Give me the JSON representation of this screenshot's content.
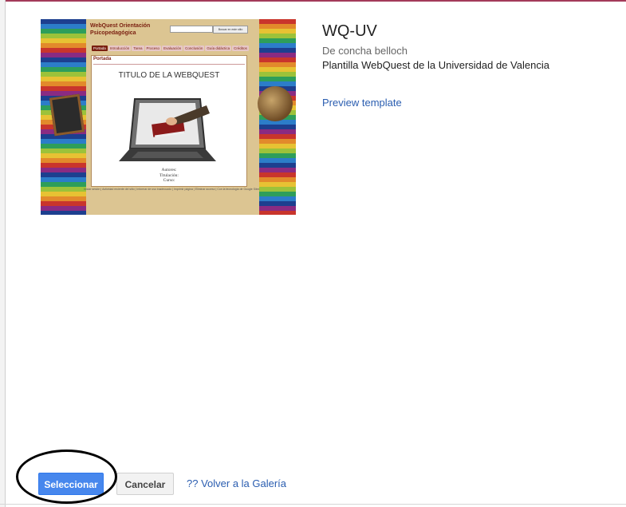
{
  "template": {
    "title": "WQ-UV",
    "author": "De concha belloch",
    "description": "Plantilla WebQuest de la Universidad de Valencia",
    "preview_link": "Preview template"
  },
  "thumbnail": {
    "site_title": "WebQuest Orientación Psicopedagógica",
    "search_button": "Buscar en este sitio",
    "nav": [
      "Portada",
      "Introducción",
      "Tarea",
      "Proceso",
      "Evaluación",
      "Conclusión",
      "Guía didáctica",
      "Créditos"
    ],
    "active_nav": "Portada",
    "page_label": "Portada",
    "heading": "TITULO DE LA WEBQUEST",
    "credits": [
      "Autores:",
      "Titulación:",
      "Curso:"
    ],
    "footer": "Iniciar sesión | Actividad reciente del sitio | Informar de uso inadecuado | Imprimir página | Eliminar acceso | Con la tecnología de Google Sites"
  },
  "actions": {
    "select_label": "Seleccionar",
    "cancel_label": "Cancelar",
    "back_label": "?? Volver a la Galería"
  },
  "colors": {
    "primary_button": "#4787ed",
    "link": "#2a5db0",
    "top_border": "#a33a5a"
  }
}
